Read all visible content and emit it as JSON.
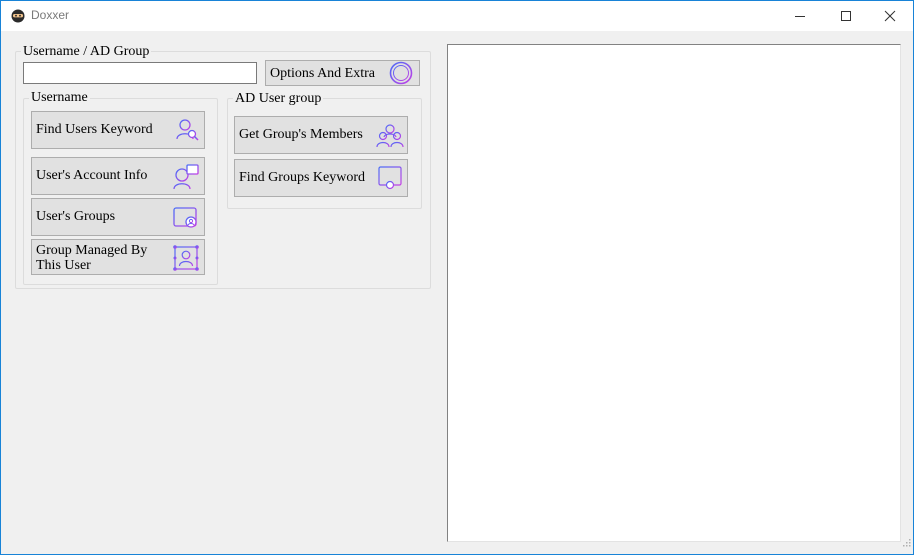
{
  "window": {
    "title": "Doxxer"
  },
  "search": {
    "group_label": "Username / AD Group",
    "input_value": "",
    "options_label": "Options And Extra"
  },
  "username_group": {
    "label": "Username",
    "buttons": [
      {
        "label": "Find Users Keyword",
        "icon": "user-search-icon"
      },
      {
        "label": "User's Account Info",
        "icon": "user-info-icon"
      },
      {
        "label": "User's Groups",
        "icon": "user-groups-icon"
      },
      {
        "label": "Group Managed By This User",
        "icon": "group-managed-icon"
      }
    ]
  },
  "ad_group": {
    "label": "AD User group",
    "buttons": [
      {
        "label": "Get Group's Members",
        "icon": "group-members-icon"
      },
      {
        "label": "Find Groups Keyword",
        "icon": "group-search-icon"
      }
    ]
  },
  "colors": {
    "icon_gradient_start": "#4a6cf7",
    "icon_gradient_end": "#c43ee6",
    "title_border": "#1883d7"
  }
}
